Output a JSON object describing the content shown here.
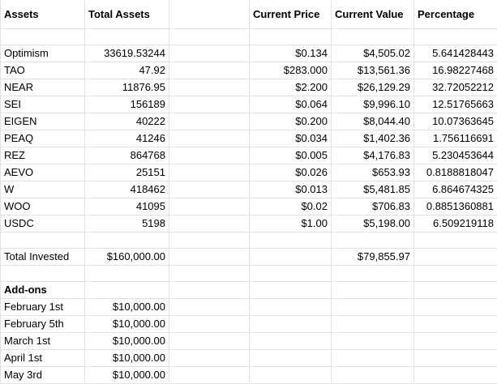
{
  "headers": {
    "assets": "Assets",
    "total_assets": "Total Assets",
    "current_price": "Current Price",
    "current_value": "Current Value",
    "percentage": "Percentage"
  },
  "rows": [
    {
      "asset": "Optimism",
      "total": "33619.53244",
      "price": "$0.134",
      "value": "$4,505.02",
      "pct": "5.641428443"
    },
    {
      "asset": "TAO",
      "total": "47.92",
      "price": "$283.000",
      "value": "$13,561.36",
      "pct": "16.98227468"
    },
    {
      "asset": "NEAR",
      "total": "11876.95",
      "price": "$2.200",
      "value": "$26,129.29",
      "pct": "32.72052212"
    },
    {
      "asset": "SEI",
      "total": "156189",
      "price": "$0.064",
      "value": "$9,996.10",
      "pct": "12.51765663"
    },
    {
      "asset": "EIGEN",
      "total": "40222",
      "price": "$0.200",
      "value": "$8,044.40",
      "pct": "10.07363645"
    },
    {
      "asset": "PEAQ",
      "total": "41246",
      "price": "$0.034",
      "value": "$1,402.36",
      "pct": "1.756116691"
    },
    {
      "asset": "REZ",
      "total": "864768",
      "price": "$0.005",
      "value": "$4,176.83",
      "pct": "5.230453644"
    },
    {
      "asset": "AEVO",
      "total": "25151",
      "price": "$0.026",
      "value": "$653.93",
      "pct": "0.8188818047"
    },
    {
      "asset": "W",
      "total": "418462",
      "price": "$0.013",
      "value": "$5,481.85",
      "pct": "6.864674325"
    },
    {
      "asset": "WOO",
      "total": "41095",
      "price": "$0.02",
      "value": "$706.83",
      "pct": "0.8851360881"
    },
    {
      "asset": "USDC",
      "total": "5198",
      "price": "$1.00",
      "value": "$5,198.00",
      "pct": "6.509219118"
    }
  ],
  "totals": {
    "label": "Total Invested",
    "invested": "$160,000.00",
    "current_value": "$79,855.97"
  },
  "addons": {
    "label": "Add-ons",
    "items": [
      {
        "date": "February 1st",
        "amount": "$10,000.00"
      },
      {
        "date": "February 5th",
        "amount": "$10,000.00"
      },
      {
        "date": "March 1st",
        "amount": "$10,000.00"
      },
      {
        "date": "April 1st",
        "amount": "$10,000.00"
      },
      {
        "date": "May 3rd",
        "amount": "$10,000.00"
      }
    ]
  }
}
